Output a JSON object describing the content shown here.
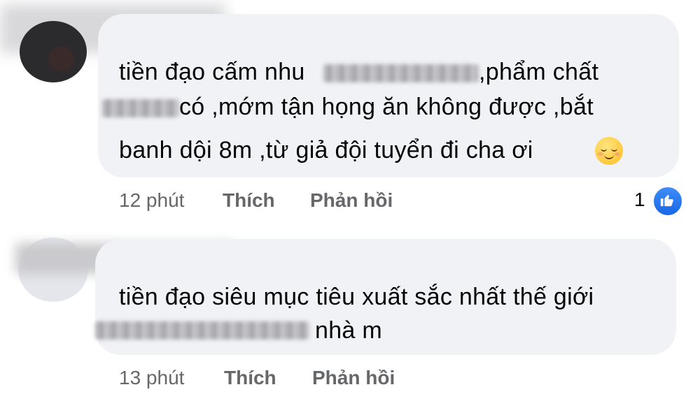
{
  "comments": [
    {
      "lines": [
        [
          "tiền đạo cấm nhu",
          ",phẩm chất"
        ],
        [
          "có ,mớm tận họng ăn không được ,bắt"
        ],
        [
          "banh dội 8m ,từ giả đội tuyển đi cha ơi"
        ]
      ],
      "emoji": "relieved-face",
      "time": "12 phút",
      "like_label": "Thích",
      "reply_label": "Phản hồi",
      "reaction_count": "1"
    },
    {
      "lines": [
        [
          "tiền đạo siêu mục tiêu xuất sắc nhất thế giới"
        ],
        [
          "nhà m"
        ]
      ],
      "time": "13 phút",
      "like_label": "Thích",
      "reply_label": "Phản hồi"
    }
  ],
  "colors": {
    "bubble": "#f0f2f5",
    "meta_text": "#65676b",
    "like_blue": "#1877f2"
  },
  "icons": [
    "like-reaction-icon",
    "relieved-face-emoji"
  ]
}
